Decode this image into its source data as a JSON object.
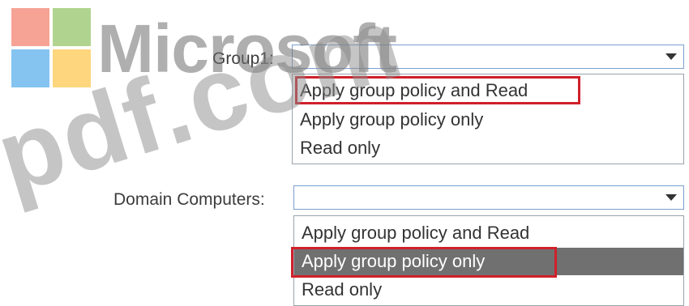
{
  "watermark": {
    "brand": "Microsoft",
    "site": "pdf.com"
  },
  "form": {
    "group1": {
      "label": "Group1:",
      "value": "",
      "options": [
        "Apply group policy and Read",
        "Apply group policy only",
        "Read only"
      ],
      "highlighted_option": "Apply group policy and Read"
    },
    "domain_computers": {
      "label": "Domain Computers:",
      "value": "",
      "options": [
        "Apply group policy and Read",
        "Apply group policy only",
        "Read only"
      ],
      "selected_option": "Apply group policy only",
      "highlighted_option": "Apply group policy only"
    }
  },
  "icons": {
    "dropdown_arrow": "chevron-down-icon",
    "logo": "microsoft-logo-icon"
  },
  "colors": {
    "highlight_border": "#d0202a",
    "selected_option_bg": "#707070",
    "combo_border": "#7a9fce"
  }
}
